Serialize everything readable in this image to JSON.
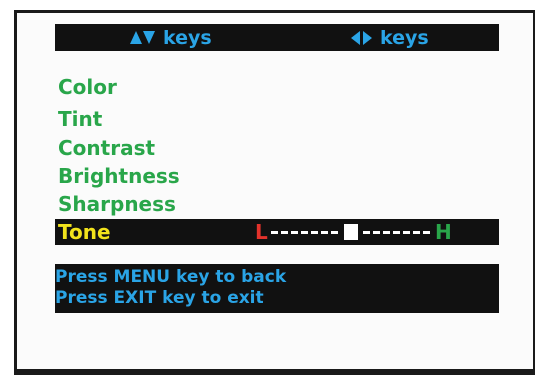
{
  "keys_bar": {
    "left_label": "keys",
    "left_icon": "up-down-arrows-icon",
    "right_label": "keys",
    "right_icon": "left-right-arrows-icon"
  },
  "menu": {
    "items": [
      {
        "label": "Color"
      },
      {
        "label": "Tint"
      },
      {
        "label": "Contrast"
      },
      {
        "label": "Brightness"
      },
      {
        "label": "Sharpness"
      }
    ],
    "selected": {
      "label": "Tone",
      "slider": {
        "low_label": "L",
        "high_label": "H",
        "value_fraction": 0.5
      }
    }
  },
  "info": {
    "line1": "Press MENU key to back",
    "line2": "Press EXIT key to exit"
  },
  "colors": {
    "menu_text": "#29a64a",
    "selected_text": "#f2e31c",
    "keys_text": "#2aa4e6",
    "low_label": "#e3322b",
    "high_label": "#29a64a",
    "bar_background": "#111111"
  }
}
